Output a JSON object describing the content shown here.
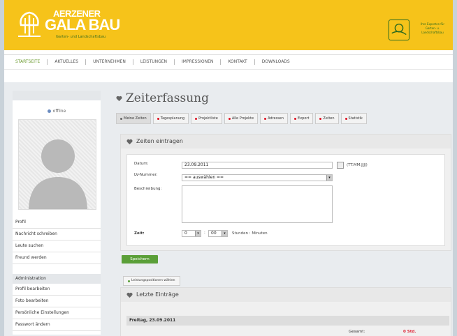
{
  "header": {
    "brand_line1": "AERZENER",
    "brand_line2": "GALA BAU",
    "brand_line3": "Garten- und Landschaftsbau",
    "seal_text": "Ihre Experten für Garten- u. Landschaftsbau"
  },
  "nav": {
    "items": [
      {
        "label": "STARTSEITE",
        "active": true
      },
      {
        "label": "AKTUELLES"
      },
      {
        "label": "UNTERNEHMEN"
      },
      {
        "label": "LEISTUNGEN"
      },
      {
        "label": "IMPRESSIONEN"
      },
      {
        "label": "KONTAKT"
      },
      {
        "label": "DOWNLOADS"
      }
    ]
  },
  "sidebar": {
    "status": "offline",
    "links": [
      "Profil",
      "Nachricht schreiben",
      "Leute suchen",
      "Freund werden"
    ],
    "admin_title": "Administration",
    "admin_links": [
      "Profil bearbeiten",
      "Foto bearbeiten",
      "Persönliche Einstellungen",
      "Passwort ändern"
    ]
  },
  "main": {
    "title": "Zeiterfassung",
    "tabs": [
      "Meine Zeiten",
      "Tagesplanung",
      "Projektliste",
      "Alle Projekte",
      "Adressen",
      "Export",
      "Zeiten",
      "Statistik"
    ],
    "panel_title": "Zeiten eintragen",
    "form": {
      "date_label": "Datum:",
      "date_value": "23.09.2011",
      "date_hint": "(TT.MM.JJJJ)",
      "lv_label": "LV-Nummer:",
      "lv_value": "== auswählen ==",
      "desc_label": "Beschreibung:",
      "time_label": "Zeit:",
      "hours": "0",
      "minutes": "00",
      "time_hint": "Stunden : Minuten"
    },
    "save_button": "Speichern",
    "subtab": "Leistungspositionen wählen",
    "last_entries_title": "Letzte Einträge",
    "day_label": "Freitag, 23.09.2011",
    "total_label": "Gesamt:",
    "total_value": "0 Std."
  }
}
